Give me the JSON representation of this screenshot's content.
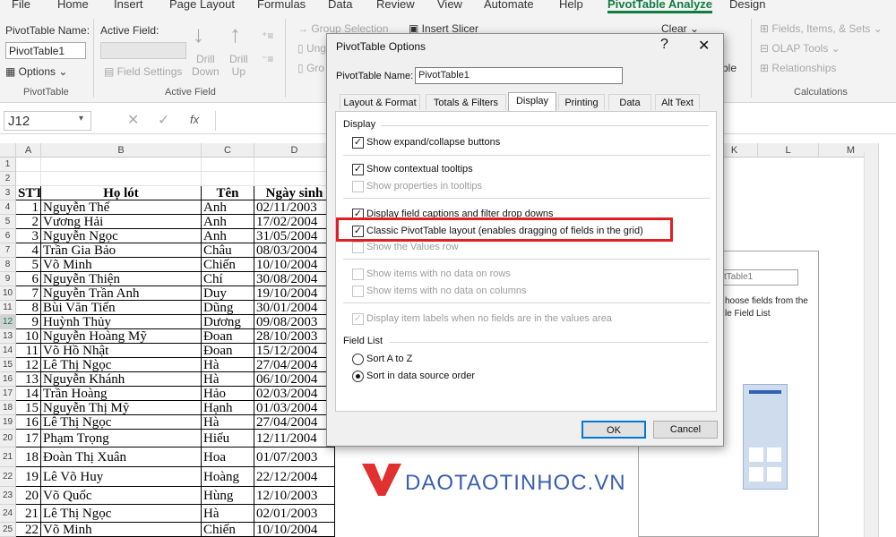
{
  "menu": [
    "File",
    "Home",
    "Insert",
    "Page Layout",
    "Formulas",
    "Data",
    "Review",
    "View",
    "Automate",
    "Help",
    "PivotTable Analyze",
    "Design"
  ],
  "ribbon": {
    "pt_name_label": "PivotTable Name:",
    "pt_name_value": "PivotTable1",
    "options_label": "Options",
    "pivottable_group": "PivotTable",
    "active_field_label": "Active Field:",
    "field_settings": "Field Settings",
    "drill_down": "Drill\nDown",
    "drill_up": "Drill\nUp",
    "active_field_group": "Active Field",
    "group_selection": "Group Selection",
    "ungroup": "Ung",
    "group": "Gro",
    "insert_slicer": "Insert Slicer",
    "clear": "Clear",
    "ble": "ble",
    "fields_items_sets": "Fields, Items, & Sets",
    "olap_tools": "OLAP Tools",
    "relationships": "Relationships",
    "calculations_group": "Calculations"
  },
  "formula_bar": {
    "name_box": "J12",
    "fx": "fx"
  },
  "columns": [
    "A",
    "B",
    "C",
    "D",
    "K",
    "L",
    "M"
  ],
  "table": {
    "header": [
      "STT",
      "Họ lót",
      "Tên",
      "Ngày sinh"
    ],
    "rows": [
      [
        "1",
        "Nguyễn Thế",
        "Anh",
        "02/11/2003"
      ],
      [
        "2",
        "Vương Hải",
        "Anh",
        "17/02/2004"
      ],
      [
        "3",
        "Nguyễn Ngọc",
        "Anh",
        "31/05/2004"
      ],
      [
        "4",
        "Trần Gia Bảo",
        "Châu",
        "08/03/2004"
      ],
      [
        "5",
        "Võ Minh",
        "Chiến",
        "10/10/2004"
      ],
      [
        "6",
        "Nguyễn Thiện",
        "Chí",
        "30/08/2004"
      ],
      [
        "7",
        "Nguyễn Trần Anh",
        "Duy",
        "19/10/2004"
      ],
      [
        "8",
        "Bùi Văn Tiến",
        "Dũng",
        "30/01/2004"
      ],
      [
        "9",
        "Huỳnh Thủy",
        "Dương",
        "09/08/2003"
      ],
      [
        "10",
        "Nguyễn Hoàng Mỹ",
        "Đoan",
        "28/10/2003"
      ],
      [
        "11",
        "Võ Hồ Nhật",
        "Đoan",
        "15/12/2004"
      ],
      [
        "12",
        "Lê Thị Ngọc",
        "Hà",
        "27/04/2004"
      ],
      [
        "13",
        "Nguyễn Khánh",
        "Hà",
        "06/10/2004"
      ],
      [
        "14",
        "Trần Hoàng",
        "Hảo",
        "02/03/2004"
      ],
      [
        "15",
        "Nguyễn Thị Mỹ",
        "Hạnh",
        "01/03/2004"
      ],
      [
        "16",
        "Lê Thị Ngọc",
        "Hà",
        "27/04/2004"
      ],
      [
        "17",
        "Phạm Trọng",
        "Hiếu",
        "12/11/2004"
      ],
      [
        "18",
        "Đoàn Thị Xuân",
        "Hoa",
        "01/07/2003"
      ],
      [
        "19",
        "Lê Võ Huy",
        "Hoàng",
        "22/12/2004"
      ],
      [
        "20",
        "Võ Quốc",
        "Hùng",
        "12/10/2003"
      ],
      [
        "21",
        "Lê Thị Ngọc",
        "Hà",
        "02/01/2003"
      ],
      [
        "22",
        "Võ Minh",
        "Chiến",
        "10/10/2004"
      ]
    ]
  },
  "row_numbers": [
    "1",
    "2",
    "3",
    "4",
    "5",
    "6",
    "7",
    "8",
    "9",
    "10",
    "11",
    "12",
    "13",
    "14",
    "15",
    "16",
    "17",
    "18",
    "19",
    "20",
    "21",
    "22",
    "23",
    "24",
    "25"
  ],
  "pivot_placeholder": {
    "name": "tTable1",
    "text1": "hoose fields from the",
    "text2": "le Field List"
  },
  "watermark": "DAOTAOTINHOC.VN",
  "dialog": {
    "title": "PivotTable Options",
    "help": "?",
    "close": "✕",
    "name_label": "PivotTable Name:",
    "name_value": "PivotTable1",
    "tabs": [
      "Layout & Format",
      "Totals & Filters",
      "Display",
      "Printing",
      "Data",
      "Alt Text"
    ],
    "display_section": "Display",
    "options": [
      {
        "label": "Show expand/collapse buttons",
        "checked": true,
        "disabled": false
      },
      {
        "label": "Show contextual tooltips",
        "checked": true,
        "disabled": false
      },
      {
        "label": "Show properties in tooltips",
        "checked": false,
        "disabled": true
      },
      {
        "label": "Display field captions and filter drop downs",
        "checked": true,
        "disabled": false
      },
      {
        "label": "Classic PivotTable layout (enables dragging of fields in the grid)",
        "checked": true,
        "disabled": false
      },
      {
        "label": "Show the Values row",
        "checked": false,
        "disabled": true
      },
      {
        "label": "Show items with no data on rows",
        "checked": false,
        "disabled": true
      },
      {
        "label": "Show items with no data on columns",
        "checked": false,
        "disabled": true
      },
      {
        "label": "Display item labels when no fields are in the values area",
        "checked": true,
        "disabled": true
      }
    ],
    "field_list_section": "Field List",
    "radios": [
      {
        "label": "Sort A to Z",
        "checked": false
      },
      {
        "label": "Sort in data source order",
        "checked": true
      }
    ],
    "ok": "OK",
    "cancel": "Cancel"
  },
  "colors": {
    "accent": "#107c41",
    "highlight": "#e02020",
    "watermark": "#e03030",
    "watermark_text": "#3a5fb0"
  }
}
